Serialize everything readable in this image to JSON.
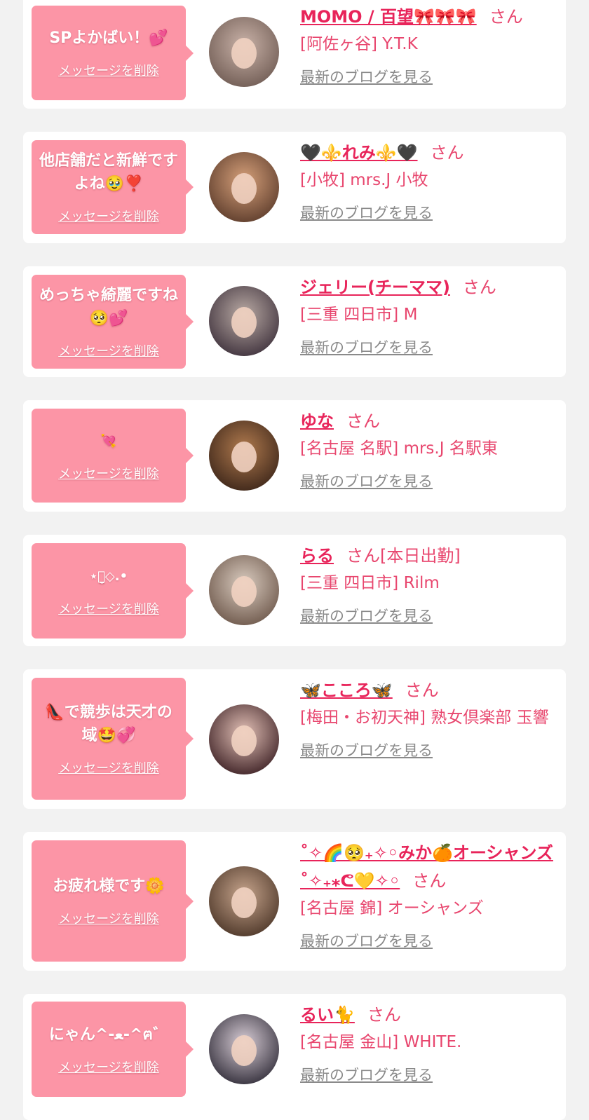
{
  "entries": [
    {
      "message": "SPよかばい！💕",
      "delete_label": "メッセージを削除",
      "name": "MOMO / 百望🎀🎀🎀",
      "honorific": "さん",
      "shop": "[阿佐ヶ谷] Y.T.K",
      "blog_link": "最新のブログを見る",
      "avatar_colors": [
        "#c9b2a8",
        "#6e5a52"
      ]
    },
    {
      "message": "他店舗だと新鮮ですよね🥹❣️",
      "delete_label": "メッセージを削除",
      "name": "🖤⚜️れみ⚜️🖤",
      "honorific": "さん",
      "shop": "[小牧] mrs.J 小牧",
      "blog_link": "最新のブログを見る",
      "avatar_colors": [
        "#d6a07a",
        "#5a3a2a"
      ]
    },
    {
      "message": "めっちゃ綺麗ですね🥺💕",
      "delete_label": "メッセージを削除",
      "name": "ジェリー(チーママ)",
      "honorific": "さん",
      "shop": "[三重 四日市] M",
      "blog_link": "最新のブログを見る",
      "avatar_colors": [
        "#b9aaa4",
        "#3c2f3a"
      ]
    },
    {
      "message": "💘",
      "delete_label": "メッセージを削除",
      "name": "ゆな",
      "honorific": "さん",
      "shop": "[名古屋 名駅] mrs.J 名駅東",
      "blog_link": "最新のブログを見る",
      "avatar_colors": [
        "#b07a4e",
        "#3a2418"
      ]
    },
    {
      "message": "⋆ꪔ̤̮◇.•",
      "delete_label": "メッセージを削除",
      "name": "らる",
      "honorific": "さん[本日出勤]",
      "shop": "[三重 四日市] Rilm",
      "blog_link": "最新のブログを見る",
      "avatar_colors": [
        "#d9cbbf",
        "#6b5548"
      ]
    },
    {
      "message": "👠で競歩は天才の域🤩💞",
      "delete_label": "メッセージを削除",
      "name": "🦋こころ🦋",
      "honorific": "さん",
      "shop": "[梅田・お初天神] 熟女倶楽部 玉響",
      "blog_link": "最新のブログを見る",
      "avatar_colors": [
        "#e2c0b6",
        "#3a1e22"
      ]
    },
    {
      "message": "お疲れ様です🌼",
      "delete_label": "メッセージを削除",
      "name": "˚✧🌈🥺₊✧◦みか🍊オーシャンズ˚✧₊⁎ᕦ💛✧◦",
      "honorific": "さん",
      "shop": "[名古屋 錦] オーシャンズ",
      "blog_link": "最新のブログを見る",
      "avatar_colors": [
        "#c6a48c",
        "#4a3426"
      ]
    },
    {
      "message": "にゃん^-ﻌ-^ฅ゛",
      "delete_label": "メッセージを削除",
      "name": "るい🐈",
      "honorific": "さん",
      "shop": "[名古屋 金山] WHITE.",
      "blog_link": "最新のブログを見る",
      "avatar_colors": [
        "#d8cdd6",
        "#2e2a36"
      ]
    }
  ]
}
